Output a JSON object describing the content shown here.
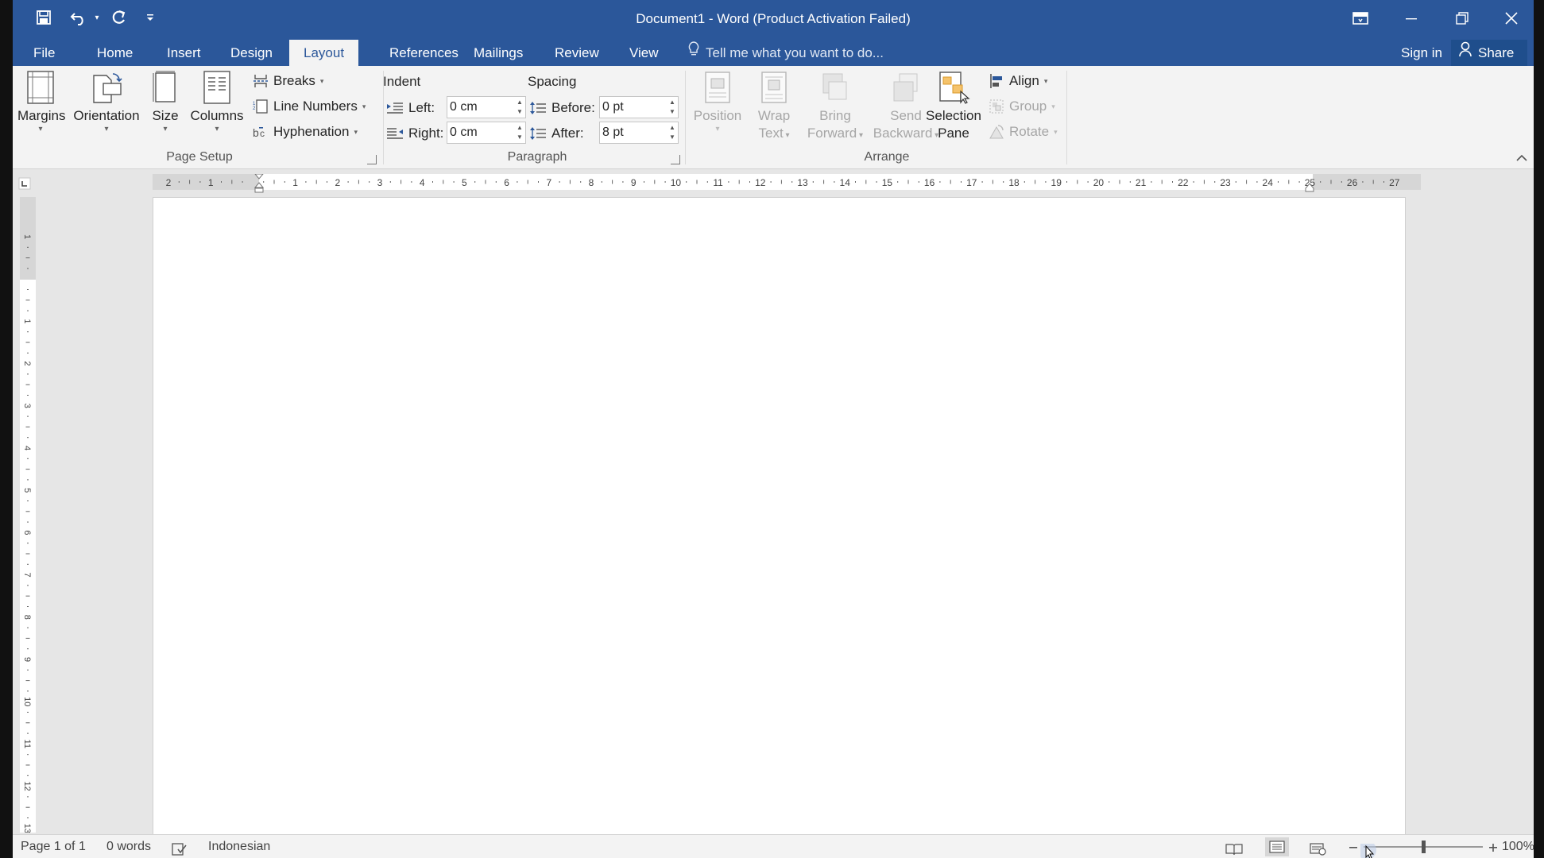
{
  "window": {
    "title": "Document1 - Word (Product Activation Failed)",
    "qat": [
      "save-icon",
      "undo-icon",
      "redo-icon",
      "customize-icon"
    ]
  },
  "tabs": [
    {
      "label": "File"
    },
    {
      "label": "Home"
    },
    {
      "label": "Insert"
    },
    {
      "label": "Design"
    },
    {
      "label": "Layout"
    },
    {
      "label": "References"
    },
    {
      "label": "Mailings"
    },
    {
      "label": "Review"
    },
    {
      "label": "View"
    }
  ],
  "active_tab": "Layout",
  "tell_me": "Tell me what you want to do...",
  "sign_in": "Sign in",
  "share": "Share",
  "page_setup": {
    "label": "Page Setup",
    "margins": "Margins",
    "orientation": "Orientation",
    "size": "Size",
    "columns": "Columns",
    "breaks": "Breaks",
    "line_numbers": "Line Numbers",
    "hyphenation": "Hyphenation"
  },
  "paragraph": {
    "label": "Paragraph",
    "indent_label": "Indent",
    "spacing_label": "Spacing",
    "left_label": "Left:",
    "right_label": "Right:",
    "before_label": "Before:",
    "after_label": "After:",
    "left_value": "0 cm",
    "right_value": "0 cm",
    "before_value": "0 pt",
    "after_value": "8 pt"
  },
  "arrange": {
    "label": "Arrange",
    "position": "Position",
    "wrap_1": "Wrap",
    "wrap_2": "Text",
    "bring_1": "Bring",
    "bring_2": "Forward",
    "send_1": "Send",
    "send_2": "Backward",
    "selection_1": "Selection",
    "selection_2": "Pane",
    "align": "Align",
    "group": "Group",
    "rotate": "Rotate"
  },
  "hruler_labels": [
    "2",
    "1",
    "",
    "1",
    "2",
    "3",
    "4",
    "5",
    "6",
    "7",
    "8",
    "9",
    "10",
    "11",
    "12",
    "13",
    "14",
    "15",
    "16",
    "17",
    "18",
    "19",
    "20",
    "21",
    "22",
    "23",
    "24",
    "25",
    "26",
    "27"
  ],
  "vruler_labels": [
    "1",
    "",
    "1",
    "2",
    "3",
    "4",
    "5",
    "6",
    "7",
    "8",
    "9",
    "10",
    "11",
    "12",
    "13"
  ],
  "status": {
    "page": "Page 1 of 1",
    "words": "0 words",
    "language": "Indonesian",
    "zoom": "100%",
    "zoom_level": 1.0
  },
  "colors": {
    "accent": "#2b579a",
    "ribbon": "#f3f3f3",
    "canvas": "#e6e6e6"
  }
}
